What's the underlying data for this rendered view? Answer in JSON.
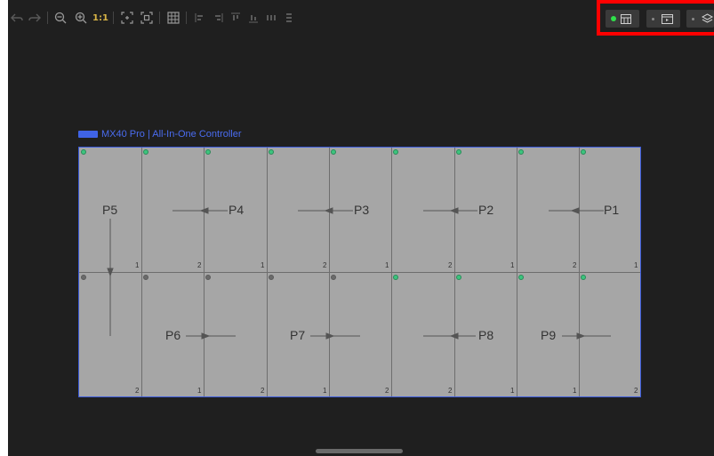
{
  "toolbar": {
    "undo_icon": "undo-icon",
    "redo_icon": "redo-icon",
    "zoom_out_icon": "zoom-out-icon",
    "zoom_in_icon": "zoom-in-icon",
    "one_to_one_label": "1:1",
    "fit_icon": "fit-screen-icon",
    "fullscreen_icon": "fullscreen-icon",
    "grid_icon": "grid-icon",
    "align_icons": [
      "align-left-icon",
      "align-right-icon",
      "align-top-icon",
      "align-bottom-icon",
      "distribute-h-icon",
      "distribute-v-icon"
    ]
  },
  "right_group": {
    "status_color": "#2fe04a",
    "buttons": [
      "layout-icon",
      "preview-icon",
      "layers-icon"
    ]
  },
  "controller": {
    "label": "MX40 Pro | All-In-One Controller"
  },
  "canvas": {
    "port_labels": [
      "P1",
      "P2",
      "P3",
      "P4",
      "P5",
      "P6",
      "P7",
      "P8",
      "P9"
    ],
    "top_row_numbers": [
      "1",
      "2",
      "1",
      "2",
      "1",
      "2",
      "1",
      "2",
      "1"
    ],
    "bottom_row_numbers": [
      "2",
      "1",
      "2",
      "1",
      "2",
      "2",
      "1",
      "1",
      "2"
    ],
    "accent_line": "#3b5bdb"
  }
}
